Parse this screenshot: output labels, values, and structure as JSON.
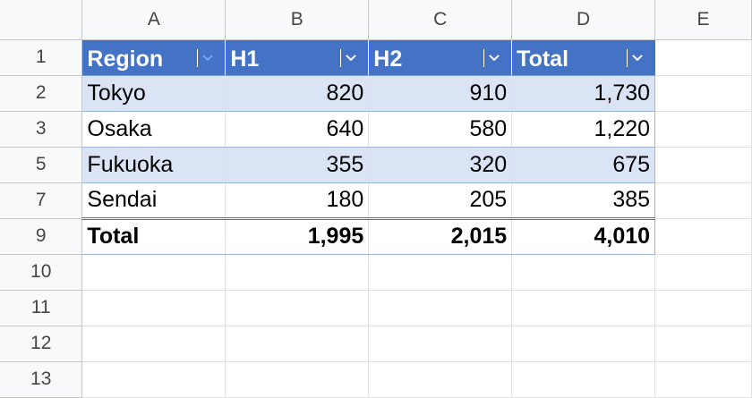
{
  "columns": [
    "A",
    "B",
    "C",
    "D",
    "E"
  ],
  "row_numbers": [
    "1",
    "2",
    "3",
    "5",
    "7",
    "9",
    "10",
    "11",
    "12",
    "13"
  ],
  "table": {
    "headers": [
      "Region",
      "H1",
      "H2",
      "Total"
    ],
    "rows": [
      [
        "Tokyo",
        "820",
        "910",
        "1,730"
      ],
      [
        "Osaka",
        "640",
        "580",
        "1,220"
      ],
      [
        "Fukuoka",
        "355",
        "320",
        "675"
      ],
      [
        "Sendai",
        "180",
        "205",
        "385"
      ]
    ],
    "total_row": [
      "Total",
      "1,995",
      "2,015",
      "4,010"
    ]
  },
  "colors": {
    "header_fill": "#4472c4",
    "band_fill": "#dbe4f5",
    "active_filter_icon": "#6fa8f5"
  },
  "icons": {
    "filter": "chevron-down-icon",
    "active_filter": "filter-chevron-active-icon"
  }
}
